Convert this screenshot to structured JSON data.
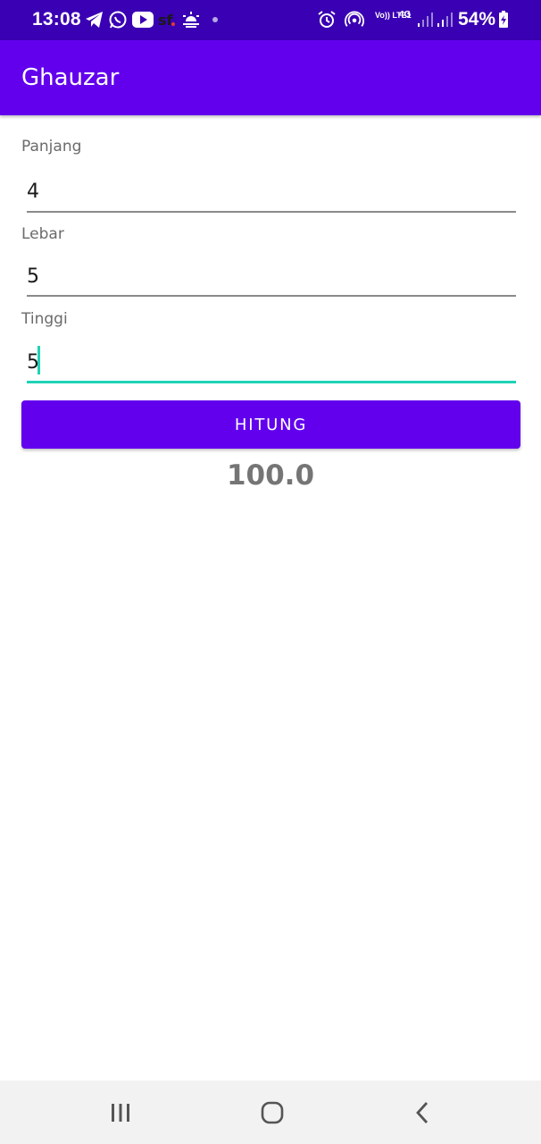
{
  "status_bar": {
    "time": "13:08",
    "battery_percent": "54%",
    "volte_label": "Vo)) LTE1",
    "network_label": "4G",
    "icons": [
      "telegram-icon",
      "whatsapp-icon",
      "youtube-icon",
      "sf-icon",
      "weather-icon",
      "dot-icon",
      "alarm-icon",
      "hotspot-icon",
      "signal-icon",
      "battery-icon"
    ],
    "colors": {
      "background": "#3a00b3",
      "foreground": "#ffffff"
    }
  },
  "app_bar": {
    "title": "Ghauzar",
    "color": "#6200ee"
  },
  "form": {
    "panjang": {
      "label": "Panjang",
      "value": "4"
    },
    "lebar": {
      "label": "Lebar",
      "value": "5"
    },
    "tinggi": {
      "label": "Tinggi",
      "value": "5"
    },
    "focus_color": "#1fd3b6"
  },
  "button": {
    "label": "HITUNG",
    "color": "#6200ee"
  },
  "result": {
    "value": "100.0"
  },
  "nav_bar": {
    "icons": [
      "recent-apps-icon",
      "home-icon",
      "back-icon"
    ]
  }
}
